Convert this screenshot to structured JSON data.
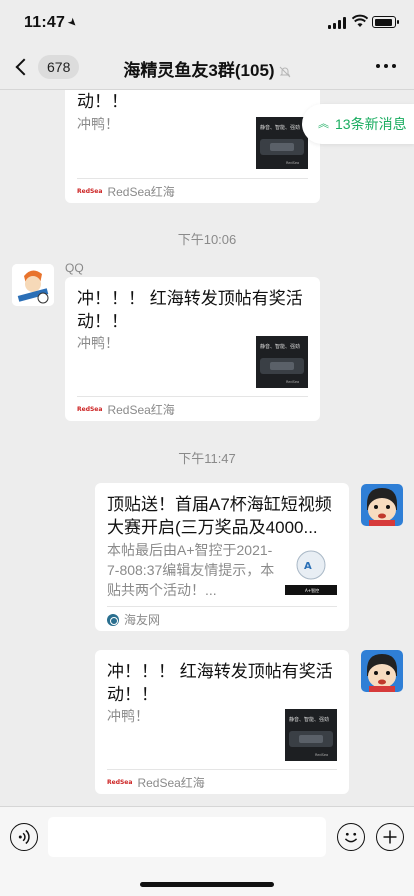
{
  "status_bar": {
    "time": "11:47"
  },
  "nav": {
    "back_count": "678",
    "title": "海精灵鱼友3群(105)"
  },
  "new_messages": {
    "label": "13条新消息"
  },
  "messages": [
    {
      "title_tail": "动！！",
      "desc": "冲鸭！",
      "source": "RedSea红海"
    },
    {
      "timestamp": "下午10:06"
    },
    {
      "sender": "QQ",
      "title": "冲！！！ 红海转发顶帖有奖活动！！",
      "desc": "冲鸭！",
      "source": "RedSea红海"
    },
    {
      "timestamp": "下午11:47"
    },
    {
      "title": "顶贴送！首届A7杯海缸短视频大赛开启(三万奖品及4000...",
      "desc": "本帖最后由A+智控于2021-7-808:37编辑友情提示，本贴共两个活动！...",
      "source": "海友网"
    },
    {
      "title": "冲！！！ 红海转发顶帖有奖活动！！",
      "desc": "冲鸭！",
      "source": "RedSea红海"
    }
  ],
  "thumb_text": {
    "redsea": "静音、智能、强劲",
    "redsea_logo": "RedSea",
    "haiyou_brand": "A+智控"
  },
  "source_logo_text": "RedSea",
  "colors": {
    "background": "#ededed",
    "accent_green": "#1aad60",
    "card": "#ffffff"
  }
}
